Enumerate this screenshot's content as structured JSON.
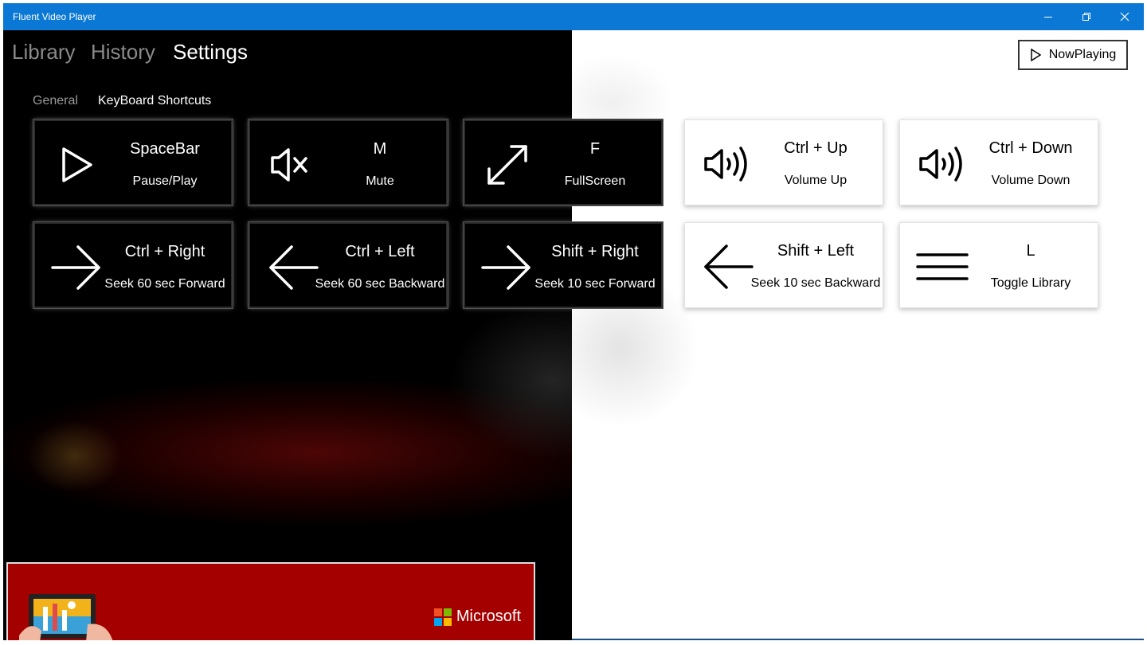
{
  "app": {
    "title": "Fluent Video Player",
    "minimize_icon": "minimize-icon",
    "maximize_icon": "restore-icon",
    "close_icon": "close-icon",
    "accent": "#0a78d4"
  },
  "nav": {
    "items": [
      {
        "label": "Library",
        "active": false
      },
      {
        "label": "History",
        "active": false
      },
      {
        "label": "Settings",
        "active": true
      }
    ],
    "sub_items": [
      {
        "label": "General",
        "active": false
      },
      {
        "label": "KeyBoard Shortcuts",
        "active": true
      }
    ]
  },
  "now_playing": {
    "label": "NowPlaying",
    "icon": "play-outline-icon"
  },
  "shortcuts": [
    {
      "key": "SpaceBar",
      "action": "Pause/Play",
      "icon": "play-icon"
    },
    {
      "key": "M",
      "action": "Mute",
      "icon": "mute-icon"
    },
    {
      "key": "F",
      "action": "FullScreen",
      "icon": "fullscreen-icon"
    },
    {
      "key": "Ctrl + Up",
      "action": "Volume Up",
      "icon": "volume-icon"
    },
    {
      "key": "Ctrl + Down",
      "action": "Volume Down",
      "icon": "volume-icon"
    },
    {
      "key": "Ctrl + Right",
      "action": "Seek 60 sec Forward",
      "icon": "arrow-right-icon"
    },
    {
      "key": "Ctrl + Left",
      "action": "Seek 60 sec Backward",
      "icon": "arrow-left-icon"
    },
    {
      "key": "Shift + Right",
      "action": "Seek 10 sec Forward",
      "icon": "arrow-right-icon"
    },
    {
      "key": "Shift + Left",
      "action": "Seek 10 sec Backward",
      "icon": "arrow-left-icon"
    },
    {
      "key": "L",
      "action": "Toggle Library",
      "icon": "hamburger-icon"
    }
  ],
  "ad": {
    "brand": "Microsoft",
    "background": "#a50000"
  }
}
